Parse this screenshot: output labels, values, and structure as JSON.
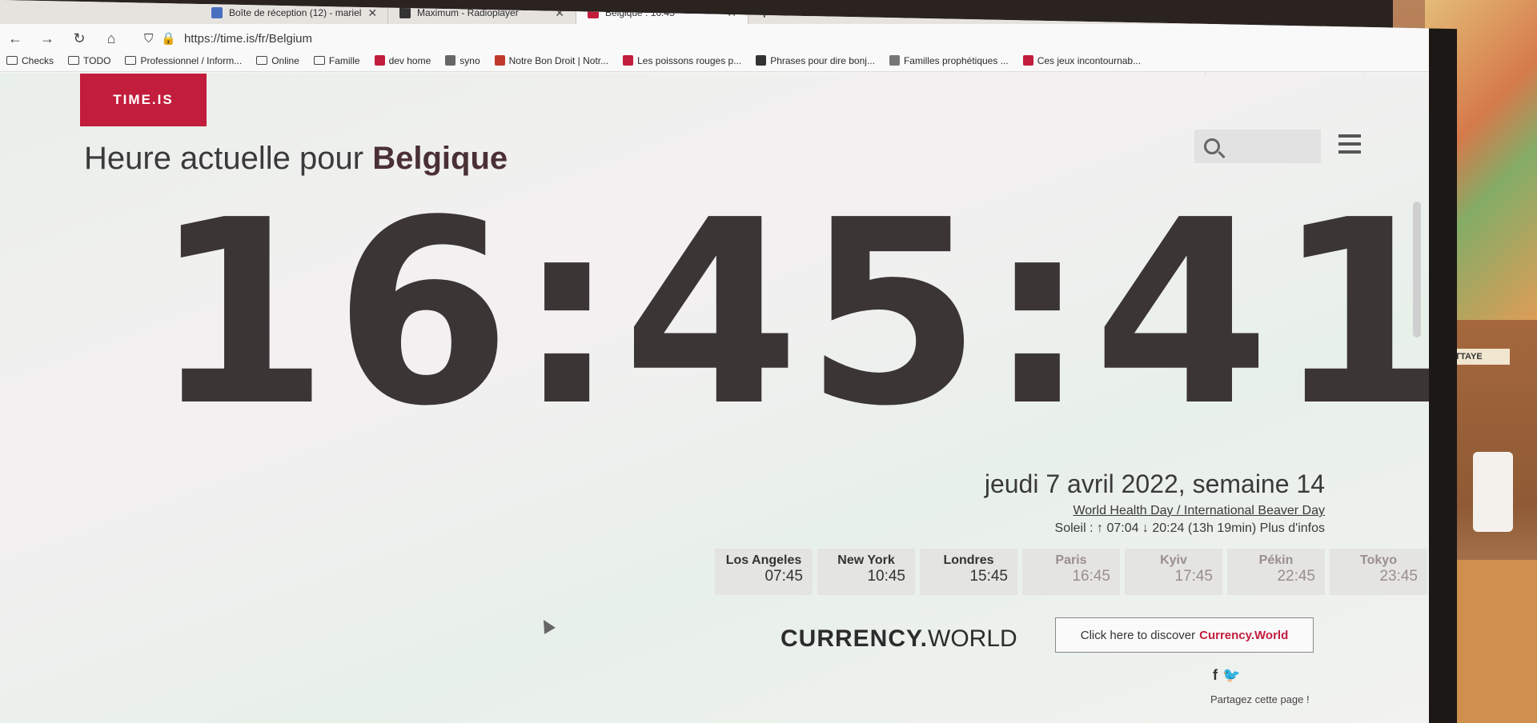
{
  "browser": {
    "tabs": [
      {
        "title": "Boîte de réception (12) - mariel",
        "color": "#4a6fc0",
        "active": false
      },
      {
        "title": "Maximum - Radioplayer",
        "color": "#333333",
        "active": false
      },
      {
        "title": "Belgique : 16:45",
        "color": "#c21d3c",
        "active": true
      }
    ],
    "tab_close": "✕",
    "new_tab": "+",
    "url": "https://time.is/fr/Belgium",
    "bookmarks": [
      {
        "label": "Checks",
        "type": "folder"
      },
      {
        "label": "TODO",
        "type": "folder"
      },
      {
        "label": "Professionnel / Inform...",
        "type": "folder"
      },
      {
        "label": "Online",
        "type": "folder"
      },
      {
        "label": "Famille",
        "type": "folder"
      },
      {
        "label": "dev home",
        "type": "github"
      },
      {
        "label": "syno",
        "type": "site"
      },
      {
        "label": "Notre Bon Droit | Notr...",
        "type": "site"
      },
      {
        "label": "Les poissons rouges p...",
        "type": "site"
      },
      {
        "label": "Phrases pour dire bonj...",
        "type": "site"
      },
      {
        "label": "Familles prophétiques ...",
        "type": "site"
      },
      {
        "label": "Ces jeux incontournab...",
        "type": "site"
      }
    ]
  },
  "site": {
    "logo": "TIME.IS",
    "headline_prefix": "Heure actuelle pour",
    "headline_place": "Belgique",
    "clock": "16:45:41",
    "date_line": "jeudi 7 avril 2022, semaine 14",
    "events": "World Health Day / International Beaver Day",
    "sun": "Soleil : ↑ 07:04 ↓ 20:24 (13h 19min) Plus d'infos",
    "cities": [
      {
        "name": "Los Angeles",
        "time": "07:45",
        "faded": false
      },
      {
        "name": "New York",
        "time": "10:45",
        "faded": false
      },
      {
        "name": "Londres",
        "time": "15:45",
        "faded": false
      },
      {
        "name": "Paris",
        "time": "16:45",
        "faded": true
      },
      {
        "name": "Kyiv",
        "time": "17:45",
        "faded": true
      },
      {
        "name": "Pékin",
        "time": "22:45",
        "faded": true
      },
      {
        "name": "Tokyo",
        "time": "23:45",
        "faded": true
      }
    ],
    "currency_bold": "CURRENCY.",
    "currency_rest": "WORLD",
    "discover_prefix": "Click here to discover",
    "discover_brand": "Currency.World",
    "share": "Partagez cette page !",
    "social_f": "f",
    "social_t": "🐦"
  },
  "room": {
    "map_label": "ATTAYE"
  },
  "colors": {
    "brand": "#c21d3c",
    "clock_text": "#3b3535"
  }
}
